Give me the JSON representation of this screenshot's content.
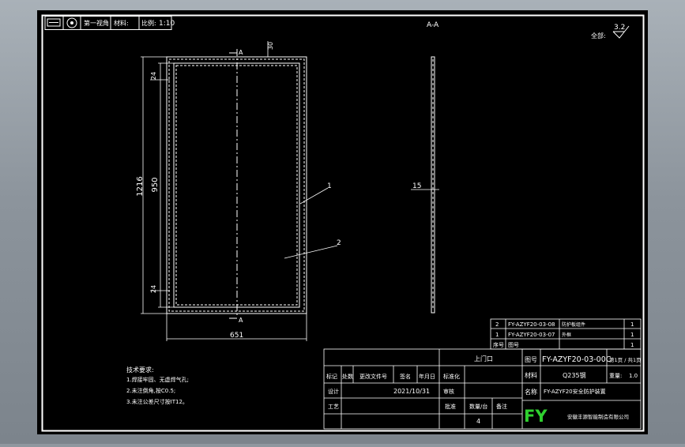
{
  "header_strip": {
    "projection": "第一视角",
    "material": "材料:",
    "scale_label": "比例:",
    "scale_value": "1:10"
  },
  "section_label": "A-A",
  "section_marker": "A",
  "roughness": {
    "label": "全部:",
    "value": "3.2"
  },
  "dimensions": {
    "top_offset": "30",
    "height_total": "1216",
    "height_inner": "950",
    "edge_top": "24",
    "edge_bottom": "24",
    "width_total": "651",
    "thickness": "15"
  },
  "balloons": [
    "1",
    "2"
  ],
  "bom": {
    "rows": [
      {
        "no": "2",
        "code": "FY-AZYF20-03-08",
        "name": "防护板组件",
        "qty": "1"
      },
      {
        "no": "1",
        "code": "FY-AZYF20-03-07",
        "name": "外框",
        "qty": "1"
      }
    ],
    "header": {
      "no": "序号",
      "code": "图号",
      "qty": "1"
    }
  },
  "title_block": {
    "part_name": "上门口",
    "drawing_no_label": "图号",
    "drawing_no": "FY-AZYF20-03-00C",
    "sheet": "第1页 / 共1页",
    "material_label": "材料",
    "material": "Q235钢",
    "weight_label": "重量:",
    "weight": "1.0",
    "name_label": "名称",
    "name": "FY-AZYF20安全防护装置",
    "rev_headers": [
      "标记",
      "处数",
      "更改文件号",
      "签名",
      "年月日"
    ],
    "design_label": "设计",
    "design_date": "2021/10/31",
    "check_label": "审核",
    "process_label": "工艺",
    "approve_label": "批准",
    "standard_label": "标准化",
    "count_label": "数量/台",
    "count": "4",
    "remark_label": "备注",
    "logo": "FY",
    "company": "安徽丰源智能制造有限公司"
  },
  "tech_notes": {
    "title": "技术要求:",
    "items": [
      "1.焊接牢固、无虚焊气孔;",
      "2.未注倒角,按C0.5;",
      "3.未注公差尺寸按IT12。"
    ]
  }
}
